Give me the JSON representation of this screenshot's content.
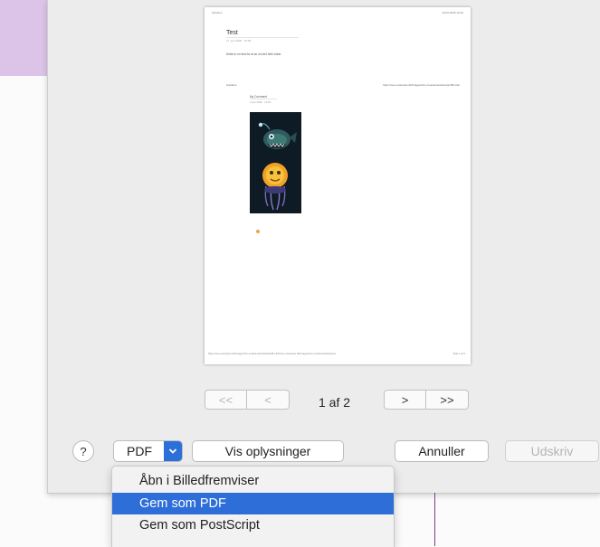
{
  "preview": {
    "header_left": "Gardens",
    "header_right": "10-02-2020 13:44",
    "title": "Test",
    "date": "17. juni 2020 · 10:00",
    "text": "Dette er en test for at se om det hele virker.",
    "left_label": "Gardens",
    "right_label": "https://see.examples.dk/images/fun-creature/anisties/pic/Bo-fish",
    "comment_name": "My Comment",
    "comment_date": "2 juni 2020 · 10:00",
    "footer_left": "https://see.examples.dk/images/fun-creature/anisties/pic/Bo-fish/see.examples.dk/images/fun-creature/anisties/pic",
    "footer_right": "Side 1 af 2"
  },
  "nav": {
    "first": "<<",
    "prev": "<",
    "next": ">",
    "last": ">>",
    "page_info": "1 af 2"
  },
  "buttons": {
    "help": "?",
    "pdf": "PDF",
    "details": "Vis oplysninger",
    "cancel": "Annuller",
    "print": "Udskriv"
  },
  "pdf_menu": {
    "items": [
      "Åbn i Billedfremviser",
      "Gem som PDF",
      "Gem som PostScript"
    ],
    "selected": "Gem som PDF"
  },
  "colors": {
    "accent": "#2e6ed8",
    "purple_window": "#dcc3e8"
  }
}
